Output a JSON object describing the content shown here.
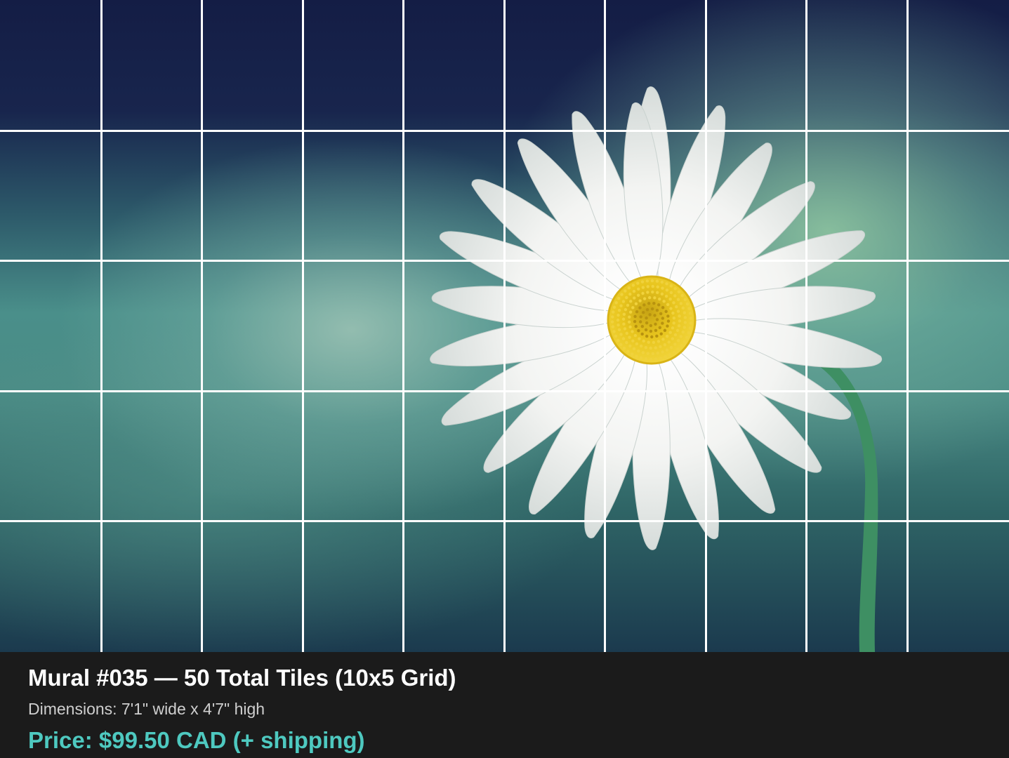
{
  "mural": {
    "title": "Mural #035 — 50 Total Tiles (10x5 Grid)",
    "dimensions": "Dimensions: 7'1\" wide x 4'7\" high",
    "price": "Price: $99.50 CAD (+ shipping)",
    "grid": {
      "columns": 10,
      "rows": 5
    },
    "image_subject": "white-daisy-icon"
  },
  "colors": {
    "price_accent": "#4ec9c0",
    "info_bar_bg": "#1b1b1b",
    "grid_line": "#ffffff",
    "petal": "#f4f5f3",
    "flower_center": "#e3c01c",
    "stem": "#3e8f63"
  }
}
